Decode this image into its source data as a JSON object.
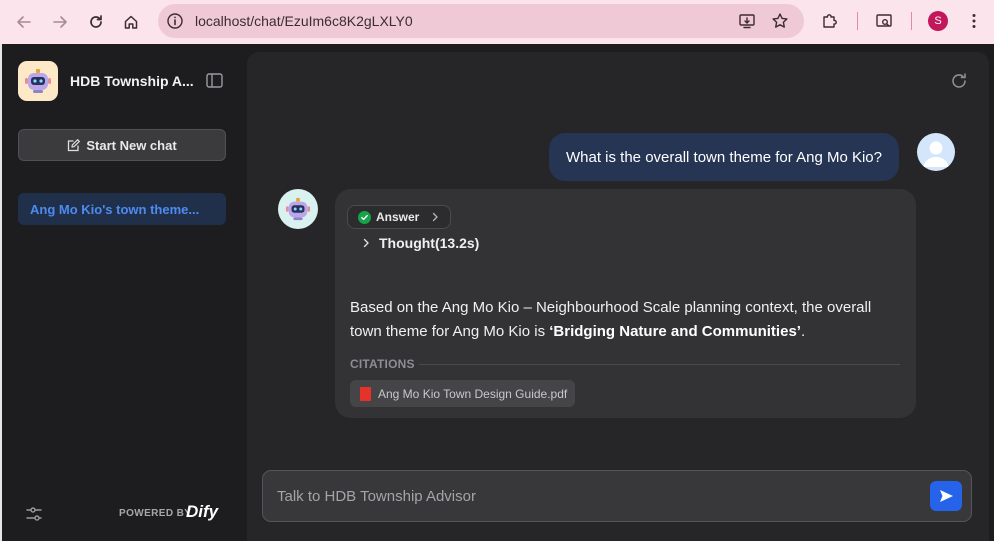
{
  "browser": {
    "url": "localhost/chat/EzuIm6c8K2gLXLY0",
    "profile_initial": "S"
  },
  "sidebar": {
    "app_title": "HDB Township A...",
    "new_chat_label": "Start New chat",
    "conversations": [
      {
        "label": "Ang Mo Kio's town theme..."
      }
    ],
    "powered_by": "POWERED BY",
    "brand": "Dify"
  },
  "chat": {
    "user_message": "What is the overall town theme for Ang Mo Kio?",
    "answer_tag": "Answer",
    "thought_label": "Thought(13.2s)",
    "answer_prefix": "Based on the Ang Mo Kio – Neighbourhood Scale planning context, the overall town theme for Ang Mo Kio is ",
    "answer_bold": "‘Bridging Nature and Communities’",
    "answer_suffix": ".",
    "citations_label": "CITATIONS",
    "citations": [
      {
        "file": "Ang Mo Kio Town Design Guide.pdf"
      }
    ]
  },
  "input": {
    "placeholder": "Talk to HDB Township Advisor"
  },
  "colors": {
    "accent": "#2563eb",
    "active_conversation_text": "#4d8bf0",
    "user_bubble": "#263553",
    "success": "#16a34a"
  }
}
